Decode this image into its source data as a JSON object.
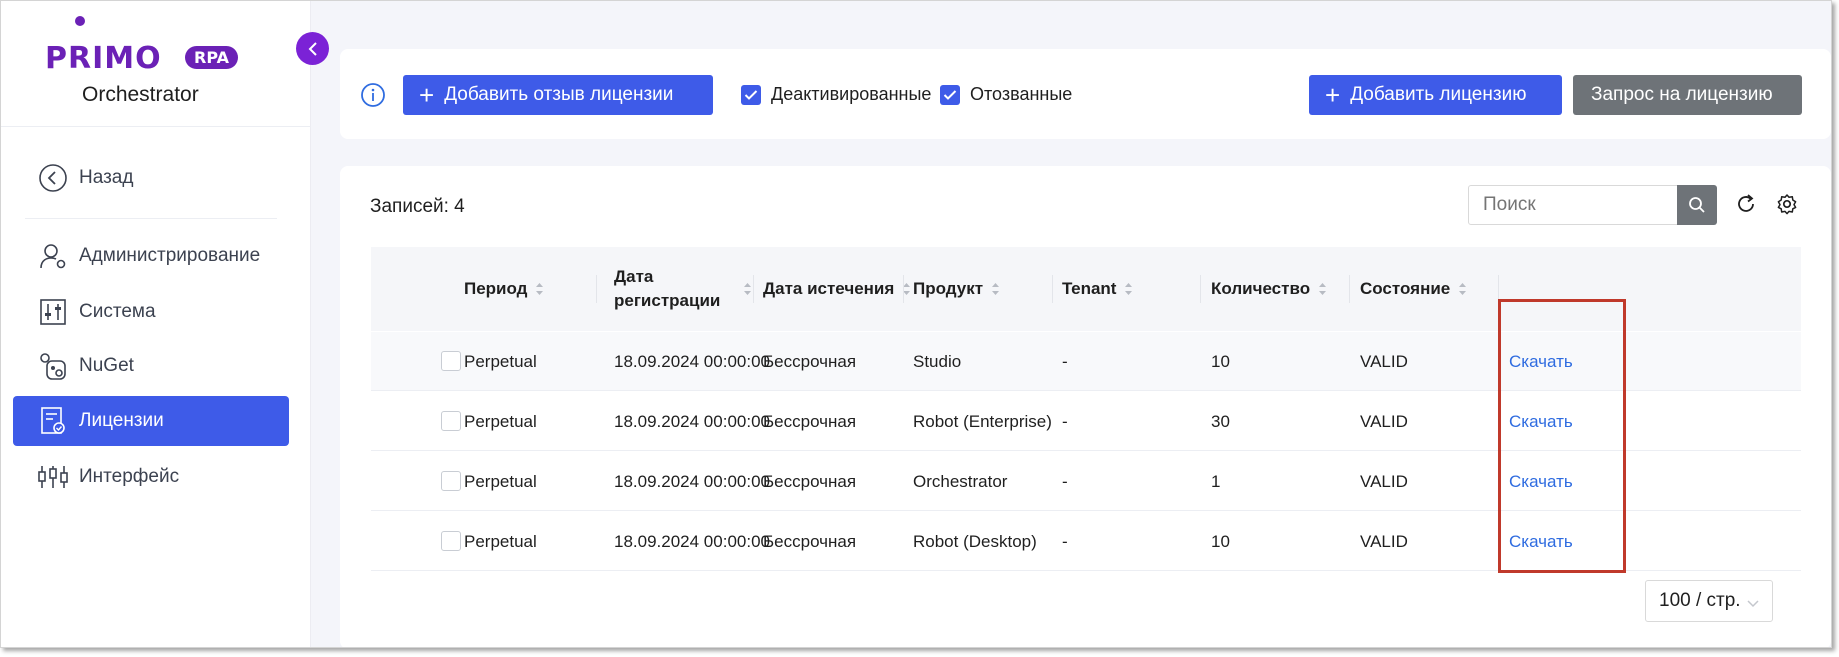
{
  "brand": {
    "logo_word": "PRIMO",
    "logo_badge": "RPA",
    "subtitle": "Orchestrator",
    "color": "#6b21b6"
  },
  "sidebar": {
    "items": [
      {
        "label": "Назад",
        "icon": "back-circle-icon"
      },
      {
        "label": "Администрирование",
        "icon": "user-gear-icon"
      },
      {
        "label": "Система",
        "icon": "sliders-icon"
      },
      {
        "label": "NuGet",
        "icon": "nuget-icon"
      },
      {
        "label": "Лицензии",
        "icon": "license-doc-icon",
        "active": true
      },
      {
        "label": "Интерфейс",
        "icon": "equalizer-icon"
      }
    ]
  },
  "toolbar": {
    "add_review_label": "Добавить отзыв лицензии",
    "deactivated_label": "Деактивированные",
    "deactivated_checked": true,
    "revoked_label": "Отозванные",
    "revoked_checked": true,
    "add_license_label": "Добавить лицензию",
    "request_license_label": "Запрос на лицензию"
  },
  "table": {
    "records_label": "Записей: 4",
    "search_placeholder": "Поиск",
    "columns": {
      "period": "Период",
      "reg_date_1": "Дата",
      "reg_date_2": "регистрации",
      "expiry": "Дата истечения",
      "product": "Продукт",
      "tenant": "Tenant",
      "quantity": "Количество",
      "state": "Состояние"
    },
    "rows": [
      {
        "period": "Perpetual",
        "reg_date": "18.09.2024 00:00:00",
        "expiry": "Бессрочная",
        "product": "Studio",
        "tenant": "-",
        "quantity": "10",
        "state": "VALID",
        "action": "Скачать"
      },
      {
        "period": "Perpetual",
        "reg_date": "18.09.2024 00:00:00",
        "expiry": "Бессрочная",
        "product": "Robot (Enterprise)",
        "tenant": "-",
        "quantity": "30",
        "state": "VALID",
        "action": "Скачать"
      },
      {
        "period": "Perpetual",
        "reg_date": "18.09.2024 00:00:00",
        "expiry": "Бессрочная",
        "product": "Orchestrator",
        "tenant": "-",
        "quantity": "1",
        "state": "VALID",
        "action": "Скачать"
      },
      {
        "period": "Perpetual",
        "reg_date": "18.09.2024 00:00:00",
        "expiry": "Бессрочная",
        "product": "Robot (Desktop)",
        "tenant": "-",
        "quantity": "10",
        "state": "VALID",
        "action": "Скачать"
      }
    ],
    "page_size": "100 / стр."
  },
  "colors": {
    "primary": "#3e5be8",
    "secondary_button": "#6e7378",
    "link": "#2f6ce0",
    "highlight": "#c0392b"
  }
}
